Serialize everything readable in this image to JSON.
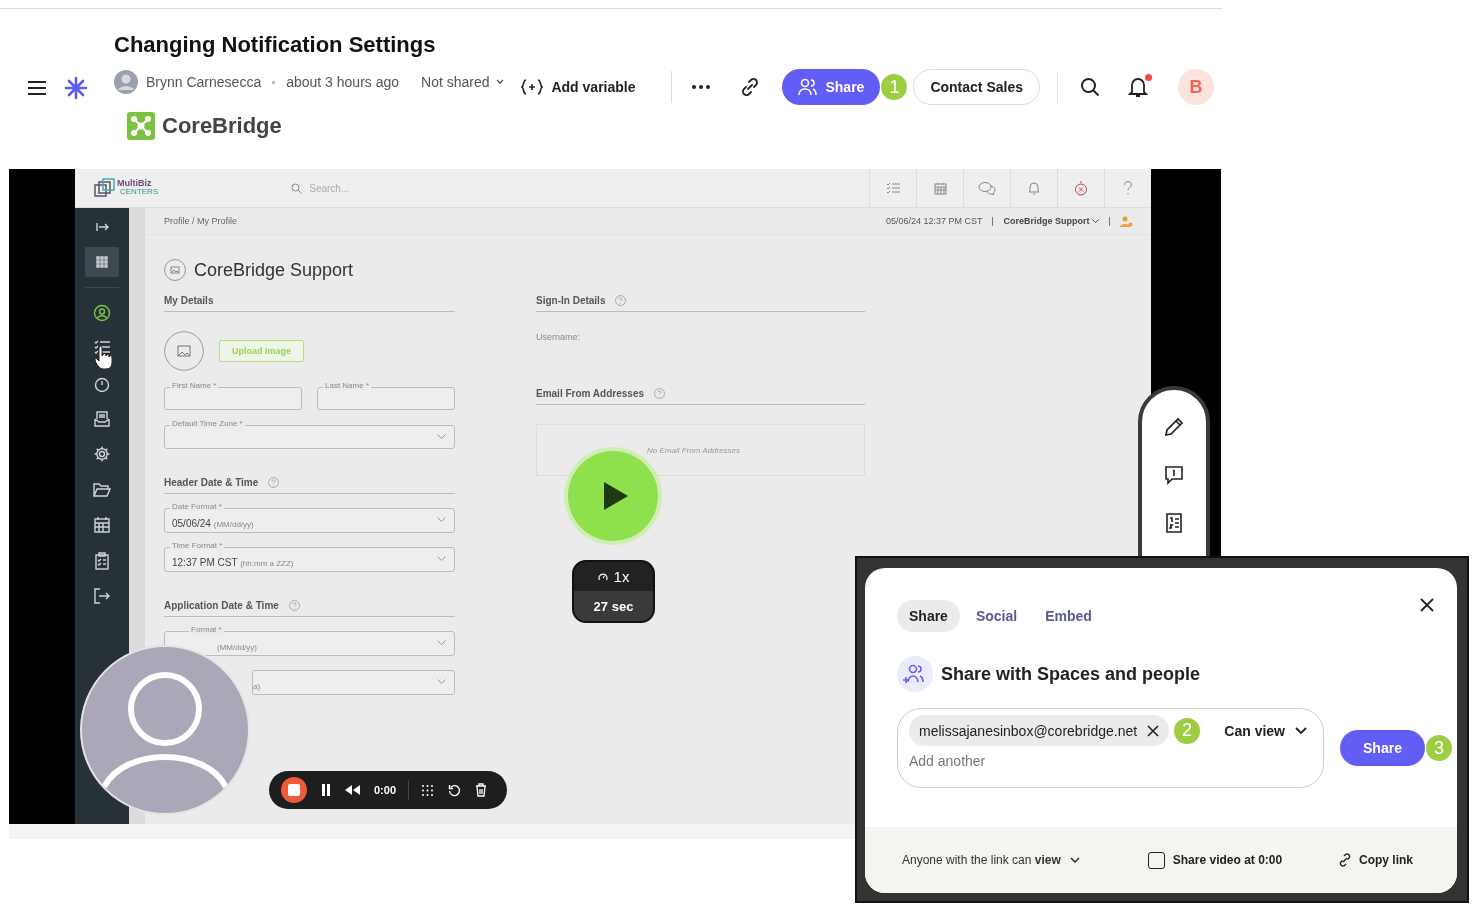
{
  "header": {
    "title": "Changing Notification Settings",
    "author": "Brynn Carnesecca",
    "time": "about 3 hours ago",
    "sharing": "Not shared",
    "brand": "CoreBridge",
    "add_variable": "Add variable",
    "share": "Share",
    "share_step": "1",
    "contact_sales": "Contact Sales",
    "notifications_unread": true,
    "avatar_letter": "B"
  },
  "recording": {
    "app": {
      "logo": "MultiBiz",
      "logo_sub": "CENTERS",
      "search_placeholder": "Search...",
      "breadcrumb": "Profile / My Profile",
      "datetime": "05/06/24 12:37 PM CST",
      "user": "CoreBridge Support",
      "page_title": "CoreBridge Support",
      "sidebar": [
        {
          "selected": false,
          "active": false
        },
        {
          "selected": true,
          "active": false
        },
        {
          "selected": false,
          "active": true
        },
        {
          "selected": false,
          "active": false
        },
        {
          "selected": false,
          "active": false
        },
        {
          "selected": false,
          "active": false
        },
        {
          "selected": false,
          "active": false
        },
        {
          "selected": false,
          "active": false
        },
        {
          "selected": false,
          "active": false
        },
        {
          "selected": false,
          "active": false
        },
        {
          "selected": false,
          "active": false
        }
      ],
      "my_details": {
        "heading": "My Details",
        "upload": "Upload Image",
        "first_name": "First Name *",
        "last_name": "Last Name *",
        "time_zone": "Default Time Zone *"
      },
      "header_datetime": {
        "heading": "Header Date & Time",
        "fields": [
          {
            "label": "Date Format *",
            "value": "05/06/24",
            "hint": "(MM/dd/yy)"
          },
          {
            "label": "Time Format *",
            "value": "12:37 PM CST",
            "hint": "(hh:mm a ZZZ)"
          }
        ]
      },
      "app_datetime": {
        "heading": "Application Date & Time",
        "fields": [
          {
            "label": "Format *",
            "hint": "(MM/dd/yy)"
          },
          {
            "hint": "a)"
          }
        ]
      },
      "sign_in": {
        "heading": "Sign-In Details",
        "username": "Username:"
      },
      "email_from": {
        "heading": "Email From Addresses",
        "empty": "No Email From Addresses"
      }
    },
    "speed": "1x",
    "duration": "27 sec",
    "elapsed": "0:00"
  },
  "share_dialog": {
    "tabs": [
      {
        "label": "Share",
        "selected": true
      },
      {
        "label": "Social",
        "selected": false
      },
      {
        "label": "Embed",
        "selected": false
      }
    ],
    "heading": "Share with Spaces and people",
    "recipient": "melissajanesinbox@corebridge.net",
    "recipient_step": "2",
    "permission": "Can view",
    "placeholder": "Add another",
    "share": "Share",
    "share_step": "3",
    "link_access": "Anyone with the link can **view**",
    "share_at": {
      "label": "Share video at 0:00",
      "checked": false
    },
    "copy_link": "Copy link"
  }
}
